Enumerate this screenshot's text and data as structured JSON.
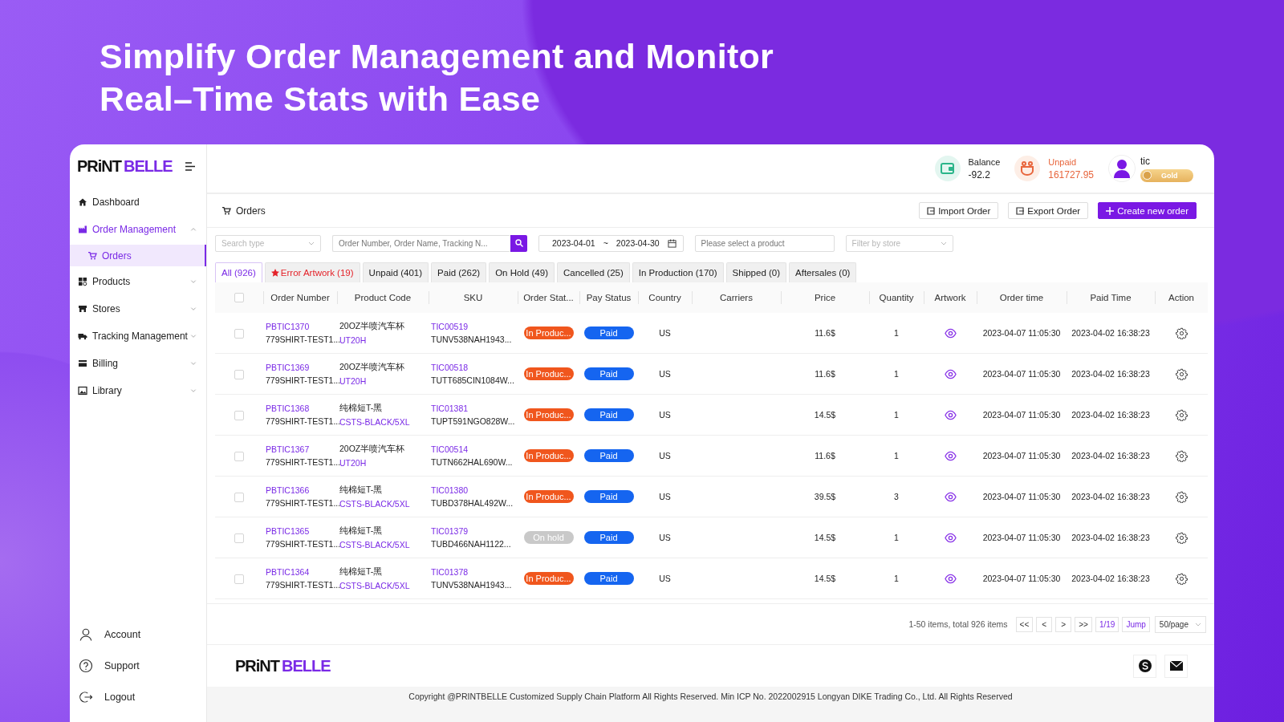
{
  "headline": [
    "Simplify Order Management and Monitor",
    "Real–Time Stats with Ease"
  ],
  "sidebar": {
    "logo": {
      "dark": "PRiNT",
      "accent": "BELLE"
    },
    "items": [
      {
        "label": "Dashboard",
        "kind": "home"
      },
      {
        "label": "Order Management",
        "kind": "factory",
        "expanded": true,
        "children": [
          {
            "label": "Orders",
            "kind": "cart",
            "selected": true
          }
        ]
      },
      {
        "label": "Products",
        "kind": "grid",
        "expanded": false
      },
      {
        "label": "Stores",
        "kind": "store",
        "expanded": false
      },
      {
        "label": "Tracking Management",
        "kind": "truck",
        "expanded": false
      },
      {
        "label": "Billing",
        "kind": "card",
        "expanded": false
      },
      {
        "label": "Library",
        "kind": "image",
        "expanded": false
      }
    ],
    "bottom_items": [
      {
        "label": "Account",
        "kind": "user"
      },
      {
        "label": "Support",
        "kind": "help"
      },
      {
        "label": "Logout",
        "kind": "logout"
      }
    ]
  },
  "header": {
    "balance": {
      "label": "Balance",
      "value": "-92.2"
    },
    "unpaid": {
      "label": "Unpaid",
      "value": "161727.95"
    },
    "user": {
      "name": "tic",
      "badge": "Gold"
    }
  },
  "page_title": "Orders",
  "actions": [
    {
      "label": "Import Order",
      "kind": "import"
    },
    {
      "label": "Export Order",
      "kind": "export"
    },
    {
      "label": "Create new order",
      "kind": "primary"
    }
  ],
  "filters": {
    "search_type": {
      "placeholder": "Search type"
    },
    "search": {
      "placeholder": "Order Number, Order Name, Tracking N..."
    },
    "date_from": "2023-04-01",
    "date_separator": "~",
    "date_to": "2023-04-30",
    "product": {
      "placeholder": "Please select a product"
    },
    "store": {
      "placeholder": "Filter by store"
    }
  },
  "tabs": [
    {
      "label": "All (926)",
      "selected": true,
      "kind": "normal"
    },
    {
      "label": "Error Artwork (19)",
      "selected": false,
      "kind": "error"
    },
    {
      "label": "Unpaid (401)",
      "selected": false,
      "kind": "normal"
    },
    {
      "label": "Paid (262)",
      "selected": false,
      "kind": "normal"
    },
    {
      "label": "On Hold (49)",
      "selected": false,
      "kind": "normal"
    },
    {
      "label": "Cancelled (25)",
      "selected": false,
      "kind": "normal"
    },
    {
      "label": "In Production (170)",
      "selected": false,
      "kind": "normal"
    },
    {
      "label": "Shipped (0)",
      "selected": false,
      "kind": "normal"
    },
    {
      "label": "Aftersales (0)",
      "selected": false,
      "kind": "normal"
    }
  ],
  "table": {
    "select_all_checked": false,
    "columns": [
      "Order Number",
      "Product Code",
      "SKU",
      "Order Stat...",
      "Pay Status",
      "Country",
      "Carriers",
      "Price",
      "Quantity",
      "Artwork",
      "Order time",
      "Paid Time",
      "Action"
    ],
    "rows": [
      {
        "checked": false,
        "order_number": "PBTIC1370",
        "order_name": "779SHIRT-TEST1...",
        "product_name": "20OZ半喷汽车杯",
        "product_code": "UT20H",
        "sku": "TIC00519",
        "sku_code": "TUNV538NAH1943...",
        "order_status": {
          "label": "In Produc...",
          "kind": "production"
        },
        "pay_status": {
          "label": "Paid",
          "kind": "paid"
        },
        "country": "US",
        "price": "11.6$",
        "quantity": "1",
        "order_time": "2023-04-07 11:05:30",
        "paid_time": "2023-04-02 16:38:23"
      },
      {
        "checked": false,
        "order_number": "PBTIC1369",
        "order_name": "779SHIRT-TEST1...",
        "product_name": "20OZ半喷汽车杯",
        "product_code": "UT20H",
        "sku": "TIC00518",
        "sku_code": "TUTT685CIN1084W...",
        "order_status": {
          "label": "In Produc...",
          "kind": "production"
        },
        "pay_status": {
          "label": "Paid",
          "kind": "paid"
        },
        "country": "US",
        "price": "11.6$",
        "quantity": "1",
        "order_time": "2023-04-07 11:05:30",
        "paid_time": "2023-04-02 16:38:23"
      },
      {
        "checked": false,
        "order_number": "PBTIC1368",
        "order_name": "779SHIRT-TEST1...",
        "product_name": "纯棉短T-黑",
        "product_code": "CSTS-BLACK/5XL",
        "sku": "TIC01381",
        "sku_code": "TUPT591NGO828W...",
        "order_status": {
          "label": "In Produc...",
          "kind": "production"
        },
        "pay_status": {
          "label": "Paid",
          "kind": "paid"
        },
        "country": "US",
        "price": "14.5$",
        "quantity": "1",
        "order_time": "2023-04-07 11:05:30",
        "paid_time": "2023-04-02 16:38:23"
      },
      {
        "checked": false,
        "order_number": "PBTIC1367",
        "order_name": "779SHIRT-TEST1...",
        "product_name": "20OZ半喷汽车杯",
        "product_code": "UT20H",
        "sku": "TIC00514",
        "sku_code": "TUTN662HAL690W...",
        "order_status": {
          "label": "In Produc...",
          "kind": "production"
        },
        "pay_status": {
          "label": "Paid",
          "kind": "paid"
        },
        "country": "US",
        "price": "11.6$",
        "quantity": "1",
        "order_time": "2023-04-07 11:05:30",
        "paid_time": "2023-04-02 16:38:23"
      },
      {
        "checked": false,
        "order_number": "PBTIC1366",
        "order_name": "779SHIRT-TEST1...",
        "product_name": "纯棉短T-黑",
        "product_code": "CSTS-BLACK/5XL",
        "sku": "TIC01380",
        "sku_code": "TUBD378HAL492W...",
        "order_status": {
          "label": "In Produc...",
          "kind": "production"
        },
        "pay_status": {
          "label": "Paid",
          "kind": "paid"
        },
        "country": "US",
        "price": "39.5$",
        "quantity": "3",
        "order_time": "2023-04-07 11:05:30",
        "paid_time": "2023-04-02 16:38:23"
      },
      {
        "checked": false,
        "order_number": "PBTIC1365",
        "order_name": "779SHIRT-TEST1...",
        "product_name": "纯棉短T-黑",
        "product_code": "CSTS-BLACK/5XL",
        "sku": "TIC01379",
        "sku_code": "TUBD466NAH1122...",
        "order_status": {
          "label": "On hold",
          "kind": "hold"
        },
        "pay_status": {
          "label": "Paid",
          "kind": "paid"
        },
        "country": "US",
        "price": "14.5$",
        "quantity": "1",
        "order_time": "2023-04-07 11:05:30",
        "paid_time": "2023-04-02 16:38:23"
      },
      {
        "checked": false,
        "order_number": "PBTIC1364",
        "order_name": "779SHIRT-TEST1...",
        "product_name": "纯棉短T-黑",
        "product_code": "CSTS-BLACK/5XL",
        "sku": "TIC01378",
        "sku_code": "TUNV538NAH1943...",
        "order_status": {
          "label": "In Produc...",
          "kind": "production"
        },
        "pay_status": {
          "label": "Paid",
          "kind": "paid"
        },
        "country": "US",
        "price": "14.5$",
        "quantity": "1",
        "order_time": "2023-04-07 11:05:30",
        "paid_time": "2023-04-02 16:38:23"
      }
    ]
  },
  "pagination": {
    "summary": "1-50 items, total 926 items",
    "nav": [
      "<<",
      "<",
      ">",
      ">>"
    ],
    "page": "1/19",
    "jump": "Jump",
    "page_size": "50/page"
  },
  "footer": {
    "logo": {
      "dark": "PRiNT",
      "accent": "BELLE"
    },
    "copyright": "Copyright @PRINTBELLE Customized Supply Chain Platform All Rights Reserved. Min ICP No. 2022002915 Longyan DIKE Trading Co., Ltd. All Rights Reserved"
  }
}
